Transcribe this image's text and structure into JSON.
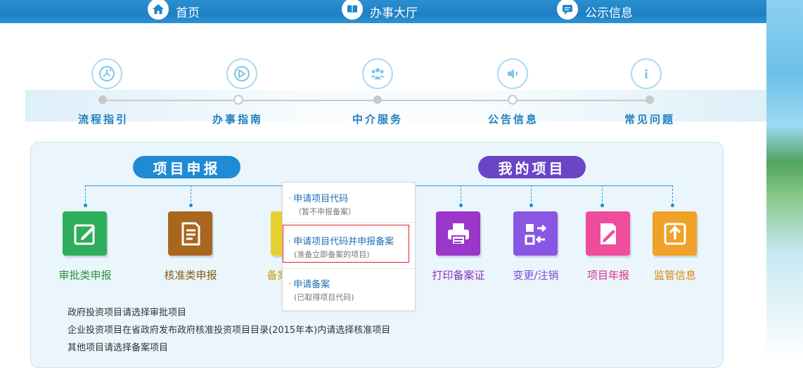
{
  "nav": {
    "items": [
      {
        "label": "首页",
        "icon": "home-icon"
      },
      {
        "label": "办事大厅",
        "icon": "book-icon"
      },
      {
        "label": "公示信息",
        "icon": "chat-icon"
      }
    ]
  },
  "steps": [
    {
      "label": "流程指引",
      "icon": "flow-icon",
      "dot": "filled"
    },
    {
      "label": "办事指南",
      "icon": "compass-icon",
      "dot": "hollow"
    },
    {
      "label": "中介服务",
      "icon": "people-icon",
      "dot": "filled"
    },
    {
      "label": "公告信息",
      "icon": "speaker-icon",
      "dot": "hollow"
    },
    {
      "label": "常见问题",
      "icon": "info-icon",
      "dot": "filled"
    }
  ],
  "sections": {
    "project_apply": "项目申报",
    "my_projects": "我的项目"
  },
  "apply_tiles": [
    {
      "label": "审批类申报",
      "icon": "edit-icon",
      "color": "#2eae5a",
      "text_color": "#2f8f3f"
    },
    {
      "label": "核准类申报",
      "icon": "document-icon",
      "color": "#a8661e",
      "text_color": "#8a5514"
    },
    {
      "label": "备案类申报",
      "icon": "file-icon",
      "color": "#e7cf2f",
      "text_color": "#c49f12"
    }
  ],
  "project_tiles": [
    {
      "label": "打印备案证",
      "icon": "printer-icon",
      "color": "#9a36c9",
      "text_color": "#8e2fbd"
    },
    {
      "label": "变更/注销",
      "icon": "swap-icon",
      "color": "#8957e3",
      "text_color": "#7d48d6"
    },
    {
      "label": "项目年报",
      "icon": "report-icon",
      "color": "#ef4c9b",
      "text_color": "#d8338a"
    },
    {
      "label": "监管信息",
      "icon": "upload-icon",
      "color": "#f0a127",
      "text_color": "#d7860e"
    }
  ],
  "popup": {
    "items": [
      {
        "title": "申请项目代码",
        "sub": "（暂不申报备案）",
        "highlighted": false
      },
      {
        "title": "申请项目代码并申报备案",
        "sub": "(准备立即备案的项目)",
        "highlighted": true
      },
      {
        "title": "申请备案",
        "sub": "(已取得项目代码)",
        "highlighted": false
      }
    ]
  },
  "notes": [
    "政府投资项目请选择审批项目",
    "企业投资项目在省政府发布政府核准投资项目目录(2015年本)内请选择核准项目",
    "其他项目请选择备案项目"
  ]
}
